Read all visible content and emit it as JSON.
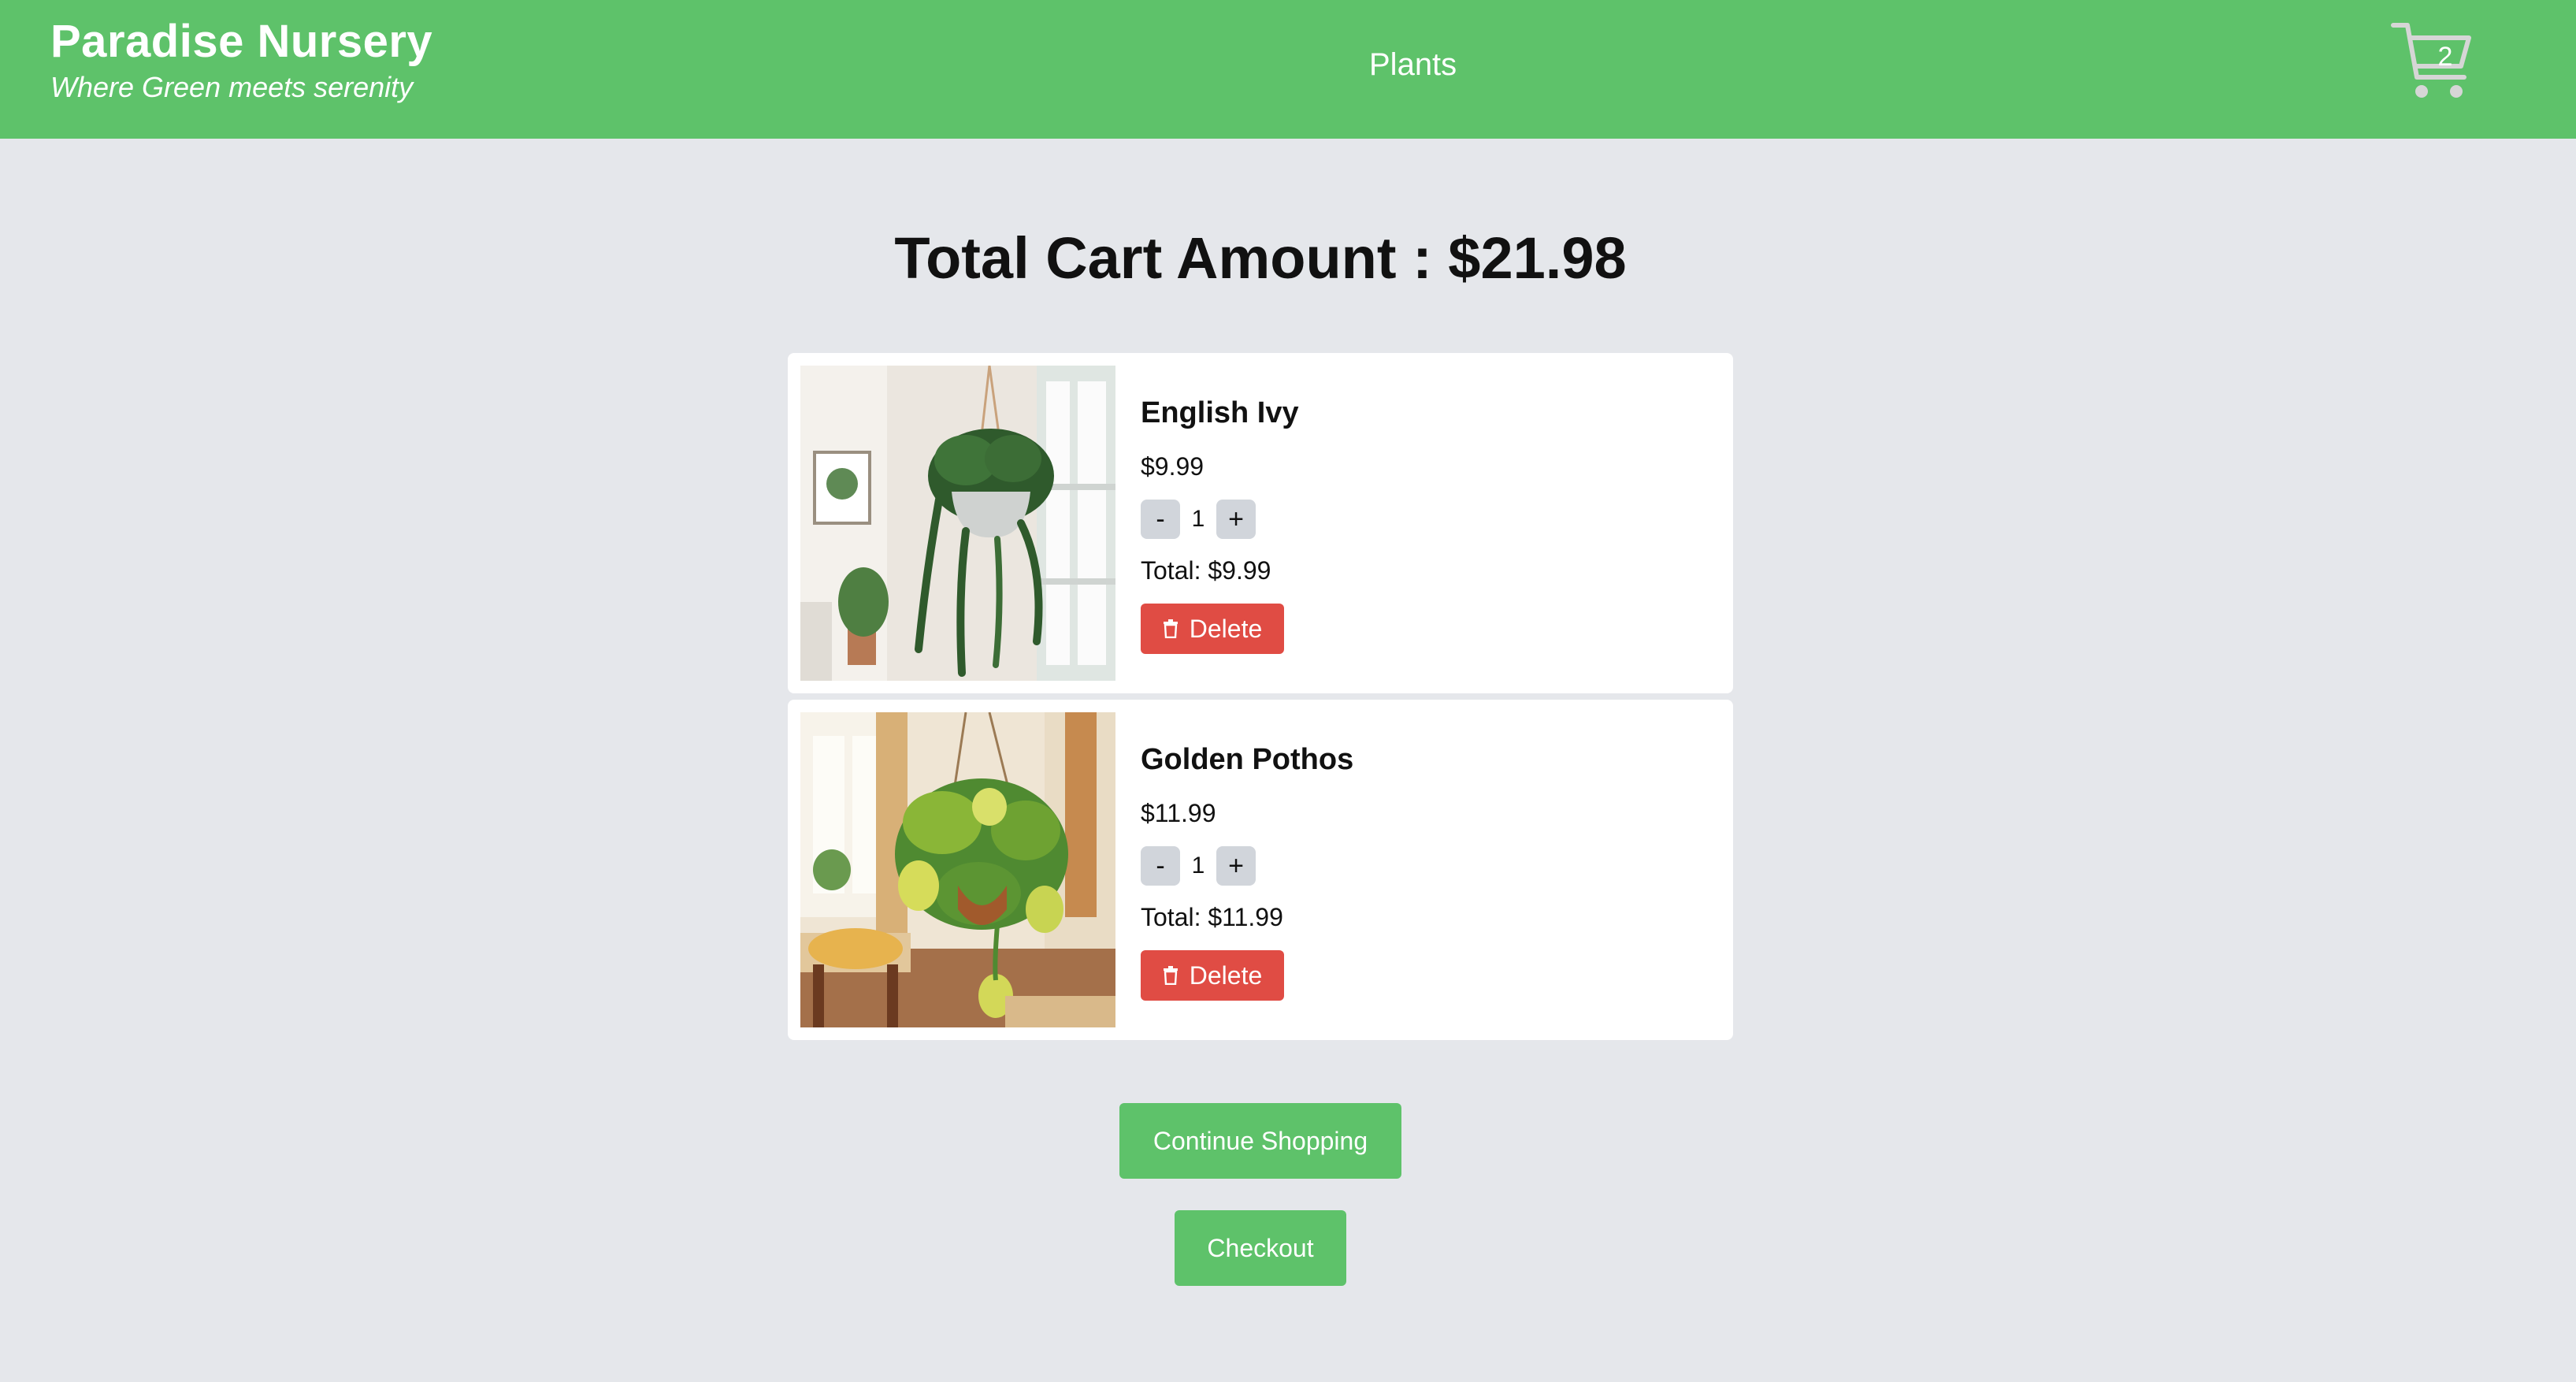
{
  "header": {
    "brand_title": "Paradise Nursery",
    "brand_tagline": "Where Green meets serenity",
    "nav_plants": "Plants",
    "cart_count": "2",
    "background_color": "#5ec26a"
  },
  "cart": {
    "total_label": "Total Cart Amount : $21.98",
    "items": [
      {
        "name": "English Ivy",
        "price": "$9.99",
        "quantity": "1",
        "total": "Total: $9.99",
        "decrement_label": "-",
        "increment_label": "+",
        "delete_label": "Delete",
        "image": "english-ivy-photo"
      },
      {
        "name": "Golden Pothos",
        "price": "$11.99",
        "quantity": "1",
        "total": "Total: $11.99",
        "decrement_label": "-",
        "increment_label": "+",
        "delete_label": "Delete",
        "image": "golden-pothos-photo"
      }
    ]
  },
  "actions": {
    "continue_label": "Continue Shopping",
    "checkout_label": "Checkout"
  },
  "colors": {
    "accent": "#5ec26a",
    "danger": "#e04c44",
    "page_background": "#e5e7eb",
    "card_background": "#ffffff"
  },
  "icons": {
    "cart": "shopping-cart-icon",
    "delete": "trash-icon"
  }
}
